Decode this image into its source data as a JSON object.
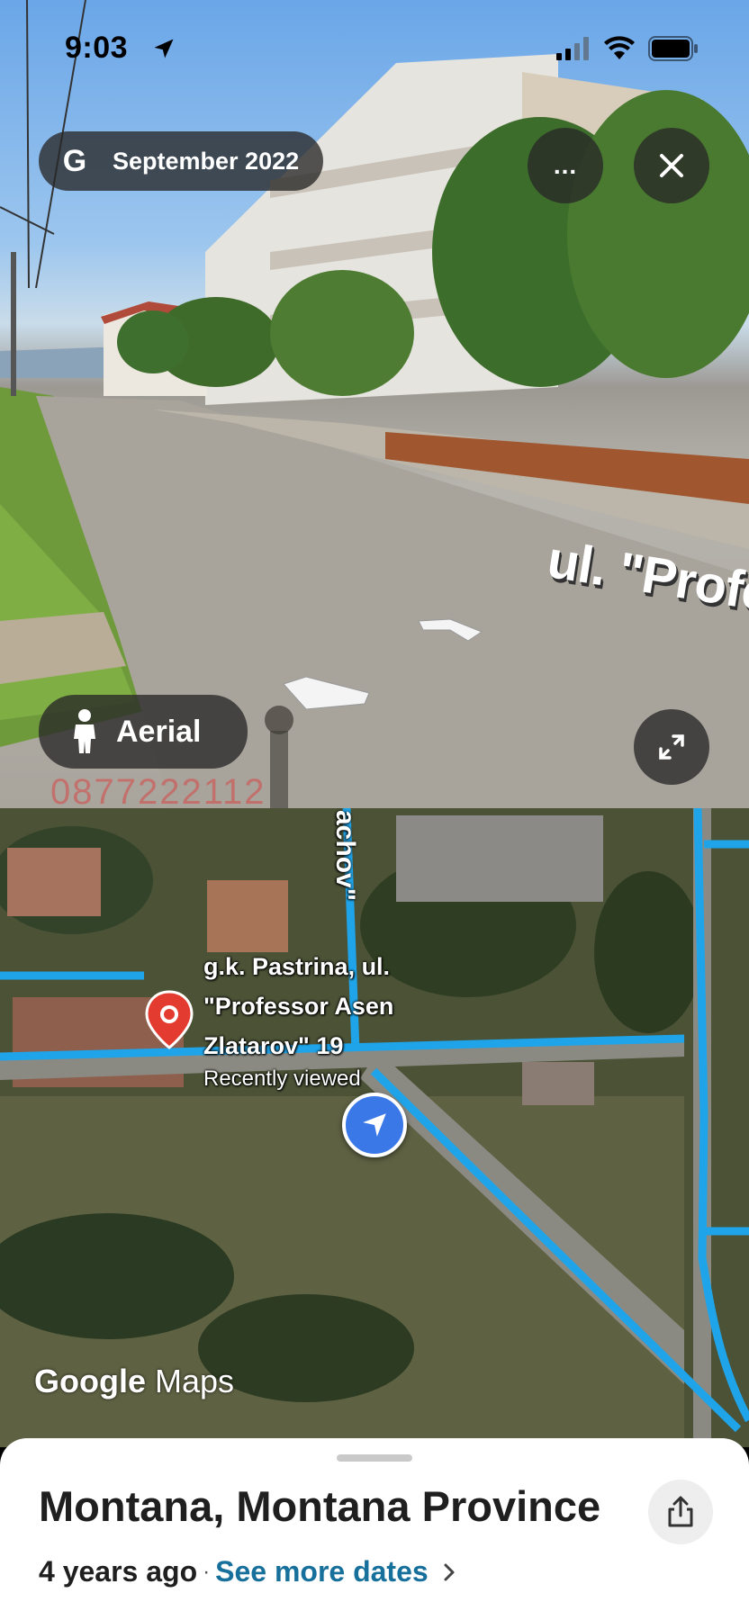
{
  "status_bar": {
    "time": "9:03"
  },
  "street_view": {
    "date_label": "September 2022",
    "date_icon_letter": "G",
    "more_label": "...",
    "aerial_label": "Aerial",
    "street_label": "ul. \"Profe",
    "watermark": "0877222112"
  },
  "map": {
    "place_name": "g.k. Pastrina, ul. \"Professor Asen Zlatarov\" 19",
    "place_line1": "g.k. Pastrina, ul.",
    "place_line2": "\"Professor Asen",
    "place_line3": "Zlatarov\" 19",
    "place_status": "Recently viewed",
    "road_label": "achov\"",
    "logo_google": "Google",
    "logo_maps": "Maps"
  },
  "sheet": {
    "title": "Montana, Montana Province",
    "age": "4 years ago",
    "separator": "·",
    "more_dates": "See more dates"
  },
  "colors": {
    "route_blue": "#1fa4e9",
    "link_blue": "#17709b",
    "pin_red": "#e33b2f",
    "my_location_blue": "#3b78e7"
  }
}
